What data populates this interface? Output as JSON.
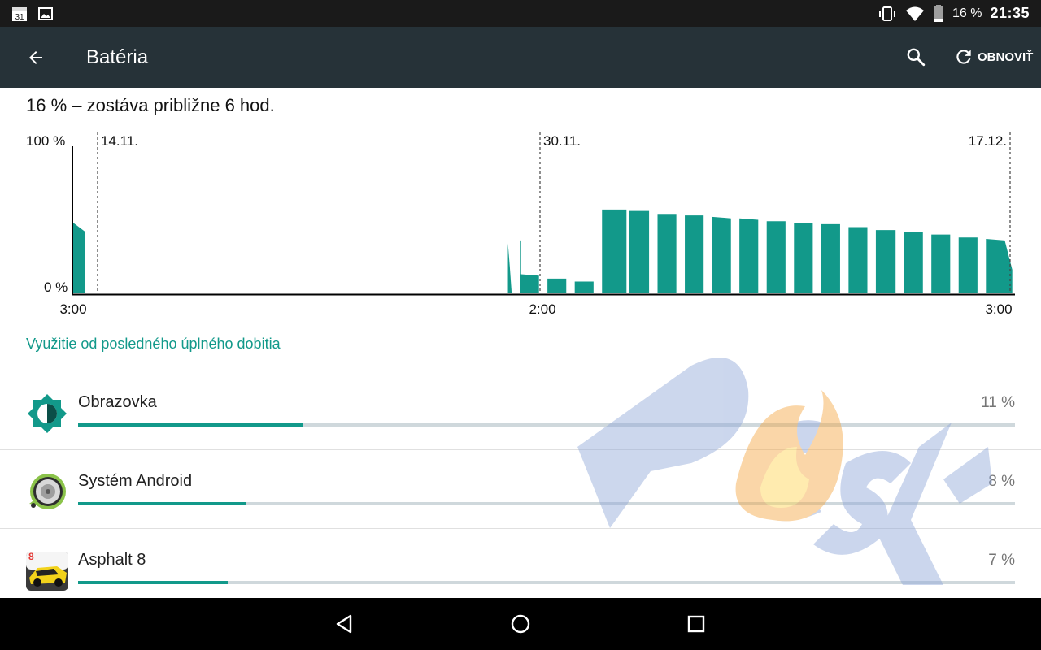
{
  "status_bar": {
    "calendar_day": "31",
    "battery_percent": "16 %",
    "time": "21:35",
    "icons": [
      "calendar-icon",
      "image-icon",
      "vibrate-icon",
      "wifi-icon",
      "battery-icon"
    ]
  },
  "toolbar": {
    "title": "Batéria",
    "refresh_label": "OBNOVIŤ",
    "background": "#263238"
  },
  "summary": "16 % – zostáva približne 6 hod.",
  "battery_chart": {
    "y_labels": [
      "100 %",
      "0 %"
    ],
    "date_labels": [
      "14.11.",
      "30.11.",
      "17.12."
    ],
    "x_labels": [
      "3:00",
      "2:00",
      "3:00"
    ],
    "bar_color": "#12998a"
  },
  "chart_data": {
    "type": "area",
    "ylim": [
      0,
      100
    ],
    "y_tick_labels": [
      "100 %",
      "0 %"
    ],
    "x_tick_labels": [
      "3:00",
      "2:00",
      "3:00"
    ],
    "date_markers": [
      "14.11.",
      "30.11.",
      "17.12."
    ],
    "segments": [
      {
        "x": [
          0.0,
          0.0125,
          0.0125,
          0.0125
        ],
        "y": [
          48,
          42,
          42,
          0
        ]
      },
      {
        "x": [
          0.462,
          0.464,
          0.466
        ],
        "y": [
          34,
          18,
          0
        ]
      },
      {
        "x": [
          0.475,
          0.476,
          0.476,
          0.495
        ],
        "y": [
          36,
          36,
          13,
          12
        ]
      },
      {
        "x": [
          0.504,
          0.524
        ],
        "y": [
          10,
          10
        ]
      },
      {
        "x": [
          0.533,
          0.553,
          0.553
        ],
        "y": [
          8,
          8,
          9
        ]
      },
      {
        "x": [
          0.562,
          0.588
        ],
        "y": [
          57,
          57
        ]
      },
      {
        "x": [
          0.591,
          0.612
        ],
        "y": [
          56,
          56
        ]
      },
      {
        "x": [
          0.621,
          0.641
        ],
        "y": [
          54,
          54
        ]
      },
      {
        "x": [
          0.65,
          0.67
        ],
        "y": [
          53,
          53
        ]
      },
      {
        "x": [
          0.679,
          0.699
        ],
        "y": [
          52,
          51
        ]
      },
      {
        "x": [
          0.708,
          0.728
        ],
        "y": [
          51,
          50
        ]
      },
      {
        "x": [
          0.737,
          0.757
        ],
        "y": [
          49,
          49
        ]
      },
      {
        "x": [
          0.766,
          0.786
        ],
        "y": [
          48,
          48
        ]
      },
      {
        "x": [
          0.795,
          0.815
        ],
        "y": [
          47,
          47
        ]
      },
      {
        "x": [
          0.824,
          0.844
        ],
        "y": [
          45,
          45
        ]
      },
      {
        "x": [
          0.853,
          0.874
        ],
        "y": [
          43,
          43
        ]
      },
      {
        "x": [
          0.883,
          0.903
        ],
        "y": [
          42,
          42
        ]
      },
      {
        "x": [
          0.912,
          0.932
        ],
        "y": [
          40,
          40
        ]
      },
      {
        "x": [
          0.941,
          0.961
        ],
        "y": [
          38,
          38
        ]
      },
      {
        "x": [
          0.97,
          0.99,
          0.998
        ],
        "y": [
          37,
          36,
          16
        ]
      }
    ]
  },
  "usage_header": "Využitie od posledného úplného dobitia",
  "apps": [
    {
      "name": "Obrazovka",
      "percent": "11 %",
      "fraction": 0.24,
      "icon": "screen-brightness-icon"
    },
    {
      "name": "Systém Android",
      "percent": "8 %",
      "fraction": 0.18,
      "icon": "android-system-icon"
    },
    {
      "name": "Asphalt 8",
      "percent": "7 %",
      "fraction": 0.16,
      "icon": "asphalt-8-icon"
    }
  ],
  "watermark": {
    "text": "pc sk"
  },
  "nav_bar": {
    "icons": [
      "back-triangle-icon",
      "home-circle-icon",
      "recents-square-icon"
    ]
  }
}
